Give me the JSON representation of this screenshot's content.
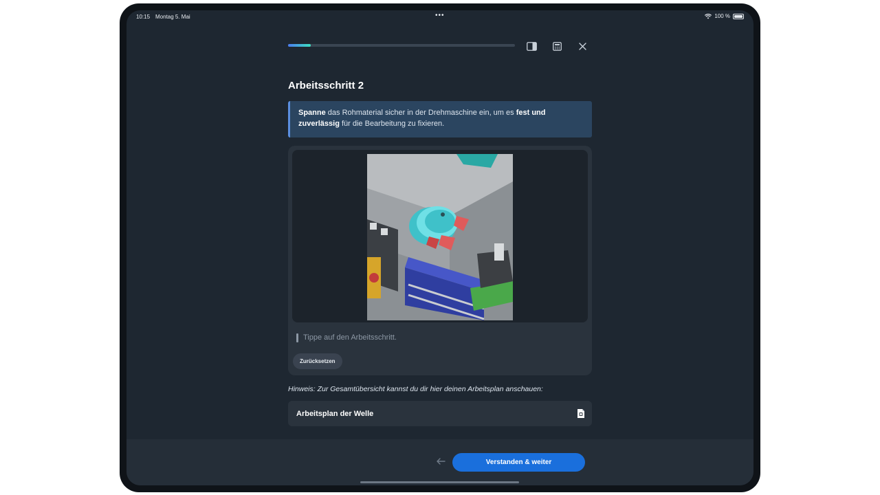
{
  "status_bar": {
    "time": "10:15",
    "date": "Montag 5. Mai",
    "battery": "100 %"
  },
  "progress": {
    "fraction": 0.1
  },
  "toolbar": {
    "panel_icon": "sidebar-panel-icon",
    "calculator_icon": "calculator-icon",
    "close_icon": "close-icon"
  },
  "step": {
    "title": "Arbeitsschritt 2",
    "instruction": {
      "part1": "Spanne",
      "part2": " das Rohmaterial sicher in der Drehmaschine ein, um es ",
      "part3": "fest und zuverlässig",
      "part4": " für die Bearbeitung zu fixieren."
    },
    "tap_hint": "Tippe auf den Arbeitsschritt.",
    "reset_label": "Zurücksetzen"
  },
  "hint": "Hinweis: Zur Gesamtübersicht kannst du dir hier deinen Arbeitsplan anschauen:",
  "plan": {
    "label": "Arbeitsplan der Welle",
    "icon": "document-icon"
  },
  "footer": {
    "back_icon": "arrow-left-icon",
    "primary_label": "Verstanden & weiter"
  },
  "colors": {
    "accent": "#1a6fdc",
    "background": "#1e2731",
    "card": "#2a333d"
  }
}
